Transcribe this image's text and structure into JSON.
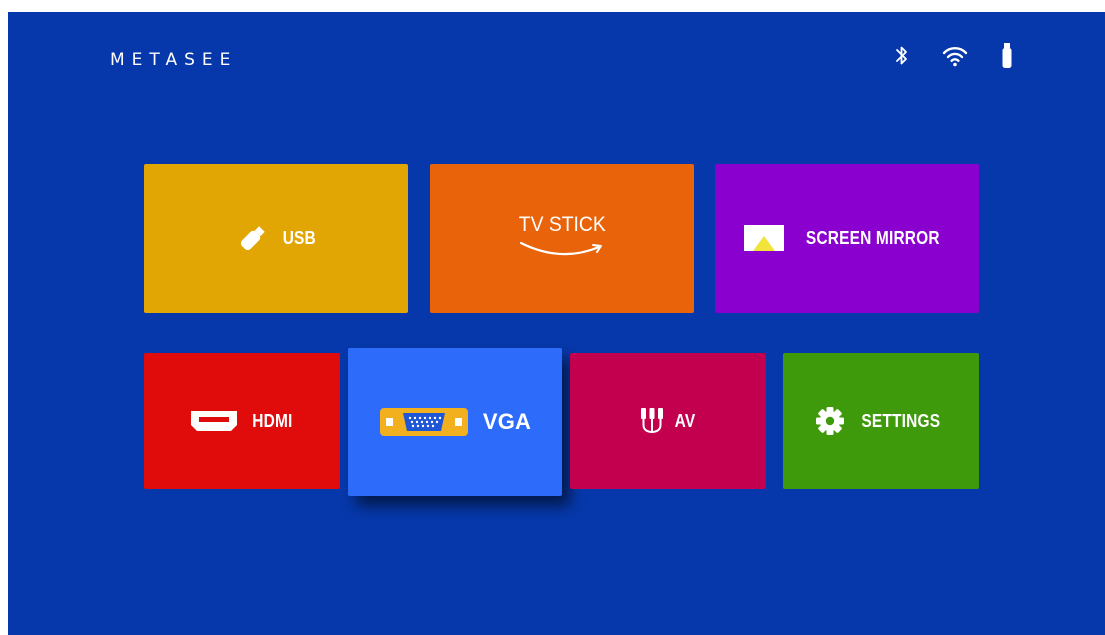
{
  "brand": {
    "logo_text": "METASEE"
  },
  "status_bar": {
    "icons": [
      "bluetooth-icon",
      "wifi-icon",
      "usb-drive-icon"
    ]
  },
  "tiles": [
    {
      "id": "usb",
      "label": "USB",
      "color": "#e2a604",
      "icon": "usb-stick-icon"
    },
    {
      "id": "tv_stick",
      "label": "TV STICK",
      "color": "#e8630a",
      "icon": "smile-arrow-icon"
    },
    {
      "id": "screen_mirror",
      "label": "SCREEN MIRROR",
      "color": "#8a00cf",
      "icon": "airplay-icon"
    },
    {
      "id": "hdmi",
      "label": "HDMI",
      "color": "#e00b0b",
      "icon": "hdmi-port-icon"
    },
    {
      "id": "vga",
      "label": "VGA",
      "color": "#2d6cfb",
      "icon": "vga-port-icon",
      "selected": true
    },
    {
      "id": "av",
      "label": "AV",
      "color": "#c2004d",
      "icon": "rca-cable-icon"
    },
    {
      "id": "settings",
      "label": "SETTINGS",
      "color": "#3f9a0b",
      "icon": "gear-icon"
    }
  ]
}
